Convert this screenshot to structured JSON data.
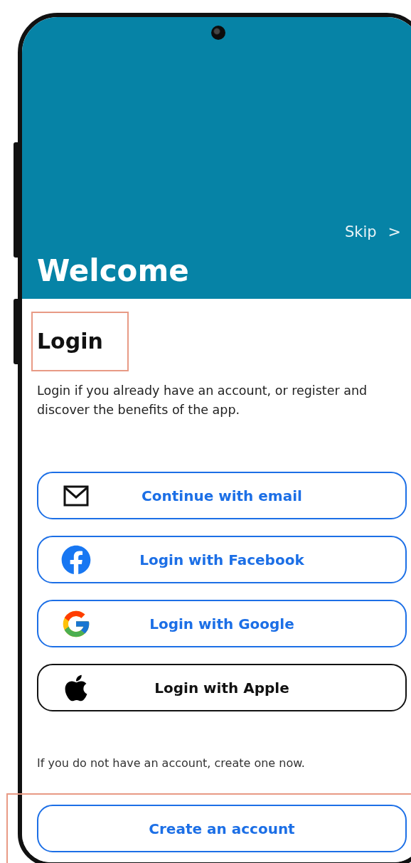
{
  "header": {
    "skip": "Skip",
    "skip_arrow": ">",
    "title": "Welcome"
  },
  "login": {
    "title": "Login",
    "description": "Login if you already have an account, or register and discover the benefits of the app.",
    "buttons": [
      {
        "kind": "email",
        "label": "Continue with email"
      },
      {
        "kind": "facebook",
        "label": "Login with Facebook"
      },
      {
        "kind": "google",
        "label": "Login with Google"
      },
      {
        "kind": "apple",
        "label": "Login with Apple"
      }
    ],
    "register_hint": "If you do not have an account, create one now.",
    "register_button": "Create an account"
  }
}
